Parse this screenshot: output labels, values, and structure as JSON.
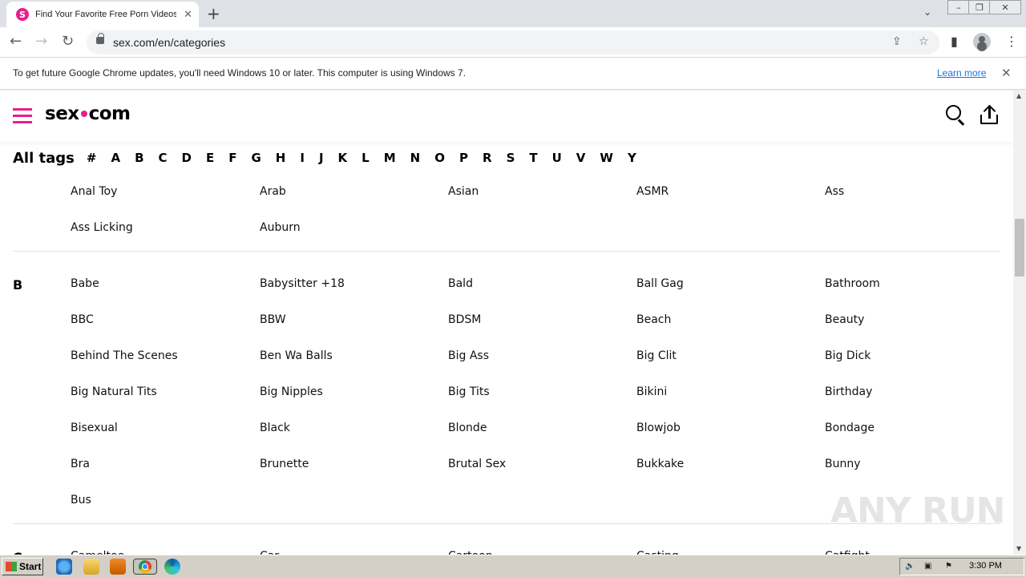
{
  "browser": {
    "tab_title": "Find Your Favorite Free Porn Videos",
    "tab_favicon_letter": "S",
    "new_tab_label": "+",
    "url": "sex.com/en/categories"
  },
  "infobar": {
    "message": "To get future Google Chrome updates, you'll need Windows 10 or later. This computer is using Windows 7.",
    "link_text": "Learn more"
  },
  "site": {
    "logo_left": "sex",
    "logo_right": "com",
    "accent_color": "#e91e8c"
  },
  "alltags": {
    "label": "All tags",
    "letters": [
      "#",
      "A",
      "B",
      "C",
      "D",
      "E",
      "F",
      "G",
      "H",
      "I",
      "J",
      "K",
      "L",
      "M",
      "N",
      "O",
      "P",
      "R",
      "S",
      "T",
      "U",
      "V",
      "W",
      "Y"
    ]
  },
  "sections": [
    {
      "letter": "",
      "tags": [
        "Anal Toy",
        "Arab",
        "Asian",
        "ASMR",
        "Ass",
        "Ass Licking",
        "Auburn"
      ]
    },
    {
      "letter": "B",
      "tags": [
        "Babe",
        "Babysitter +18",
        "Bald",
        "Ball Gag",
        "Bathroom",
        "BBC",
        "BBW",
        "BDSM",
        "Beach",
        "Beauty",
        "Behind The Scenes",
        "Ben Wa Balls",
        "Big Ass",
        "Big Clit",
        "Big Dick",
        "Big Natural Tits",
        "Big Nipples",
        "Big Tits",
        "Bikini",
        "Birthday",
        "Bisexual",
        "Black",
        "Blonde",
        "Blowjob",
        "Bondage",
        "Bra",
        "Brunette",
        "Brutal Sex",
        "Bukkake",
        "Bunny",
        "Bus"
      ]
    },
    {
      "letter": "C",
      "tags": [
        "Cameltoe",
        "Car",
        "Cartoon",
        "Casting",
        "Catfight"
      ]
    }
  ],
  "watermark": "ANY RUN",
  "taskbar": {
    "start_label": "Start",
    "clock": "3:30 PM"
  }
}
